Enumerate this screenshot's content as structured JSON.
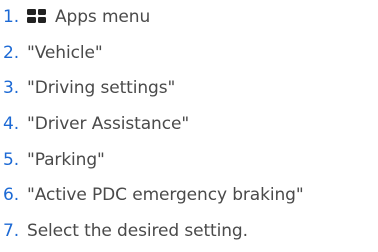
{
  "colors": {
    "number": "#1c69d4",
    "text": "#4a4a4a",
    "icon": "#222222"
  },
  "steps": [
    {
      "number": "1.",
      "icon": "apps-grid-icon",
      "label": "Apps menu"
    },
    {
      "number": "2.",
      "label": "\"Vehicle\""
    },
    {
      "number": "3.",
      "label": "\"Driving settings\""
    },
    {
      "number": "4.",
      "label": "\"Driver Assistance\""
    },
    {
      "number": "5.",
      "label": "\"Parking\""
    },
    {
      "number": "6.",
      "label": "\"Active PDC emergency braking\""
    },
    {
      "number": "7.",
      "label": "Select the desired setting."
    }
  ]
}
